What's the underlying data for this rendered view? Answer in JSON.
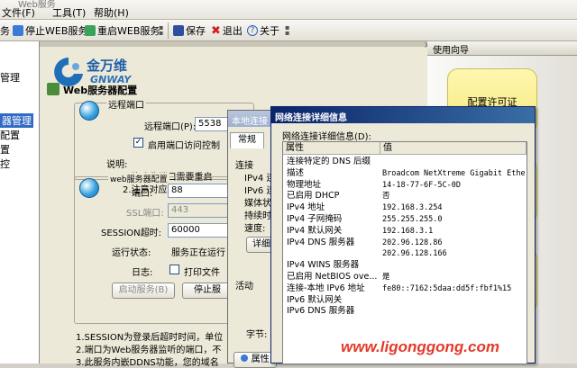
{
  "window": {
    "title_fragment": "Web服务"
  },
  "menubar": {
    "items": [
      "文件(F)",
      "工具(T)",
      "帮助(H)"
    ]
  },
  "toolbar": {
    "stop_web": "停止WEB服务",
    "restart_web": "重启WEB服务",
    "save": "保存",
    "exit": "退出",
    "about": "关于",
    "lead_fragment": "务"
  },
  "left_tree": {
    "items": [
      "管理",
      "器管理",
      "配置",
      "置",
      "控"
    ]
  },
  "logo": {
    "cn": "金万维",
    "en": "GNWAY"
  },
  "web_config": {
    "title": "Web服务器配置",
    "remote_section": "远程端口",
    "remote_port_label": "远程端口(P):",
    "remote_port_value": "5538",
    "enable_remote_label": "启用端口访问控制",
    "note_title": "说明:",
    "note_1": "1.修改此端口需要重启",
    "note_2": "2.注意对应地修改防火",
    "web_section": "web服务器配置",
    "port_label": "端口:",
    "port_value": "88",
    "ssl_label": "SSL端口:",
    "ssl_value": "443",
    "session_label": "SESSION超时:",
    "session_value": "60000",
    "status_label": "运行状态:",
    "status_value": "服务正在运行",
    "log_label": "日志:",
    "print_file_label": "打印文件",
    "start_button": "启动服务(B)",
    "stop_button": "停止服",
    "footnote_1": "1.SESSION为登录后超时时间，单位",
    "footnote_2": "2.端口为Web服务器监听的端口，不",
    "footnote_3": "3.此服务内嵌DDNS功能，您的域名"
  },
  "guide_panel": {
    "title": "使用向导",
    "button_1": "配置许可证"
  },
  "local_conn_dialog": {
    "title": "本地连接",
    "tab": "常规",
    "section_connection": "连接",
    "rows": [
      "IPv4 连",
      "IPv6 连",
      "媒体状",
      "持续时",
      "速度:"
    ],
    "details_button": "详细",
    "section_activity": "活动",
    "bytes_label": "字节:",
    "properties_button": "属性"
  },
  "details_dialog": {
    "title": "网络连接详细信息",
    "subtitle": "网络连接详细信息(D):",
    "col_property": "属性",
    "col_value": "值",
    "rows": [
      {
        "p": "连接特定的 DNS 后缀",
        "v": ""
      },
      {
        "p": "描述",
        "v": "Broadcom NetXtreme Gigabit Ethern"
      },
      {
        "p": "物理地址",
        "v": "14-18-77-6F-5C-0D"
      },
      {
        "p": "已启用 DHCP",
        "v": "否"
      },
      {
        "p": "IPv4 地址",
        "v": "192.168.3.254"
      },
      {
        "p": "IPv4 子网掩码",
        "v": "255.255.255.0"
      },
      {
        "p": "IPv4 默认网关",
        "v": "192.168.3.1"
      },
      {
        "p": "IPv4 DNS 服务器",
        "v": "202.96.128.86"
      },
      {
        "p": "",
        "v": "202.96.128.166"
      },
      {
        "p": "IPv4 WINS 服务器",
        "v": ""
      },
      {
        "p": "已启用 NetBIOS ove...",
        "v": "是"
      },
      {
        "p": "连接-本地 IPv6 地址",
        "v": "fe80::7162:5daa:dd5f:fbf1%15"
      },
      {
        "p": "IPv6 默认网关",
        "v": ""
      },
      {
        "p": "IPv6 DNS 服务器",
        "v": ""
      }
    ]
  },
  "watermark": "www.ligonggong.com",
  "colors": {
    "accent_title": "#0a246a",
    "watermark": "#e23a2a",
    "guide_button": "#f5e87a"
  },
  "icons": [
    "stop-icon",
    "restart-icon",
    "save-icon",
    "exit-icon",
    "about-icon",
    "globe-icon",
    "gnway-logo"
  ]
}
